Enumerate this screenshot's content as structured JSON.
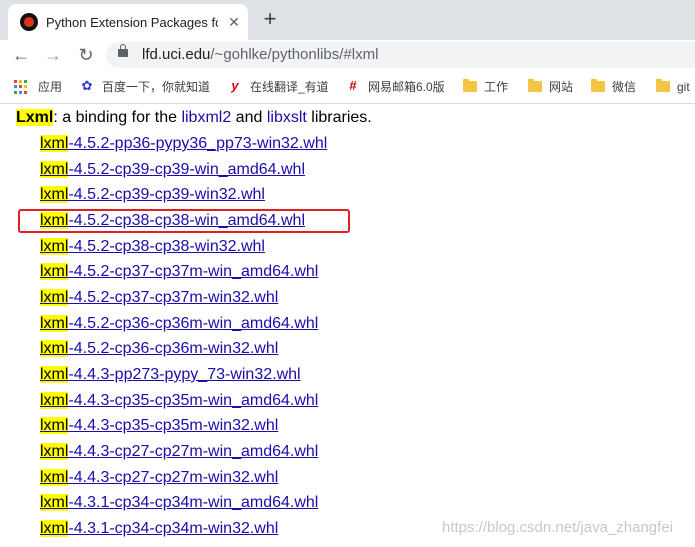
{
  "tab": {
    "title": "Python Extension Packages for",
    "close": "✕",
    "new_tab": "+"
  },
  "toolbar": {
    "back": "←",
    "forward": "→",
    "reload": "↻"
  },
  "address": {
    "host": "lfd.uci.edu",
    "path": "/~gohlke/pythonlibs/#lxml"
  },
  "bookmarks": [
    {
      "label": "应用",
      "icon": "apps-icon"
    },
    {
      "label": "百度一下，你就知道",
      "icon": "baidu-paw-icon"
    },
    {
      "label": "在线翻译_有道",
      "icon": "youdao-y-icon"
    },
    {
      "label": "网易邮箱6.0版",
      "icon": "netease-mail-icon"
    },
    {
      "label": "工作",
      "icon": "folder-icon"
    },
    {
      "label": "网站",
      "icon": "folder-icon"
    },
    {
      "label": "微信",
      "icon": "folder-icon"
    },
    {
      "label": "git",
      "icon": "folder-icon"
    }
  ],
  "heading": {
    "package": "Lxml",
    "text1": ": a binding for the ",
    "link1": "libxml2",
    "text2": " and ",
    "link2": "libxslt",
    "text3": " libraries."
  },
  "files": [
    {
      "prefix": "lxml",
      "suffix": "-4.5.2-pp36-pypy36_pp73-win32.whl"
    },
    {
      "prefix": "lxml",
      "suffix": "-4.5.2-cp39-cp39-win_amd64.whl"
    },
    {
      "prefix": "lxml",
      "suffix": "-4.5.2-cp39-cp39-win32.whl"
    },
    {
      "prefix": "lxml",
      "suffix": "-4.5.2-cp38-cp38-win_amd64.whl",
      "selected": true
    },
    {
      "prefix": "lxml",
      "suffix": "-4.5.2-cp38-cp38-win32.whl"
    },
    {
      "prefix": "lxml",
      "suffix": "-4.5.2-cp37-cp37m-win_amd64.whl"
    },
    {
      "prefix": "lxml",
      "suffix": "-4.5.2-cp37-cp37m-win32.whl"
    },
    {
      "prefix": "lxml",
      "suffix": "-4.5.2-cp36-cp36m-win_amd64.whl"
    },
    {
      "prefix": "lxml",
      "suffix": "-4.5.2-cp36-cp36m-win32.whl"
    },
    {
      "prefix": "lxml",
      "suffix": "-4.4.3-pp273-pypy_73-win32.whl"
    },
    {
      "prefix": "lxml",
      "suffix": "-4.4.3-cp35-cp35m-win_amd64.whl"
    },
    {
      "prefix": "lxml",
      "suffix": "-4.4.3-cp35-cp35m-win32.whl"
    },
    {
      "prefix": "lxml",
      "suffix": "-4.4.3-cp27-cp27m-win_amd64.whl"
    },
    {
      "prefix": "lxml",
      "suffix": "-4.4.3-cp27-cp27m-win32.whl"
    },
    {
      "prefix": "lxml",
      "suffix": "-4.3.1-cp34-cp34m-win_amd64.whl"
    },
    {
      "prefix": "lxml",
      "suffix": "-4.3.1-cp34-cp34m-win32.whl"
    }
  ],
  "watermark": "https://blog.csdn.net/java_zhangfei",
  "colors": {
    "highlight": "#ffff00",
    "link": "#1a0dab",
    "selection_border": "#e02020"
  }
}
